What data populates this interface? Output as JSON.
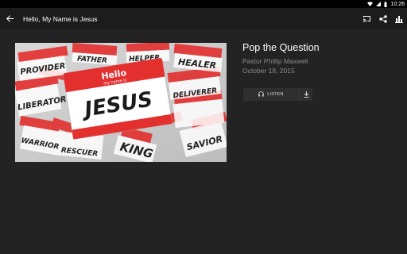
{
  "status_bar": {
    "time": "10:26"
  },
  "toolbar": {
    "title": "Hello, My Name is Jesus"
  },
  "sermon": {
    "title": "Pop the Question",
    "speaker": "Pastor Phillip Maxwell",
    "date": "October 18, 2015"
  },
  "player": {
    "listen_label": "LISTEN"
  },
  "artwork": {
    "tag_header": "Hello",
    "tag_subheader": "my name is",
    "tag_name": "JESUS",
    "background_words": [
      "FATHER",
      "HELPER",
      "HEALER",
      "PROVIDER",
      "LIBERATOR",
      "DELIVERER",
      "WARRIOR",
      "RESCUER",
      "KING",
      "SAVIOR"
    ]
  },
  "colors": {
    "background": "#232323",
    "toolbar": "#1c1c1c",
    "accent_red": "#e3302f",
    "muted_text": "#8a8a8a"
  }
}
